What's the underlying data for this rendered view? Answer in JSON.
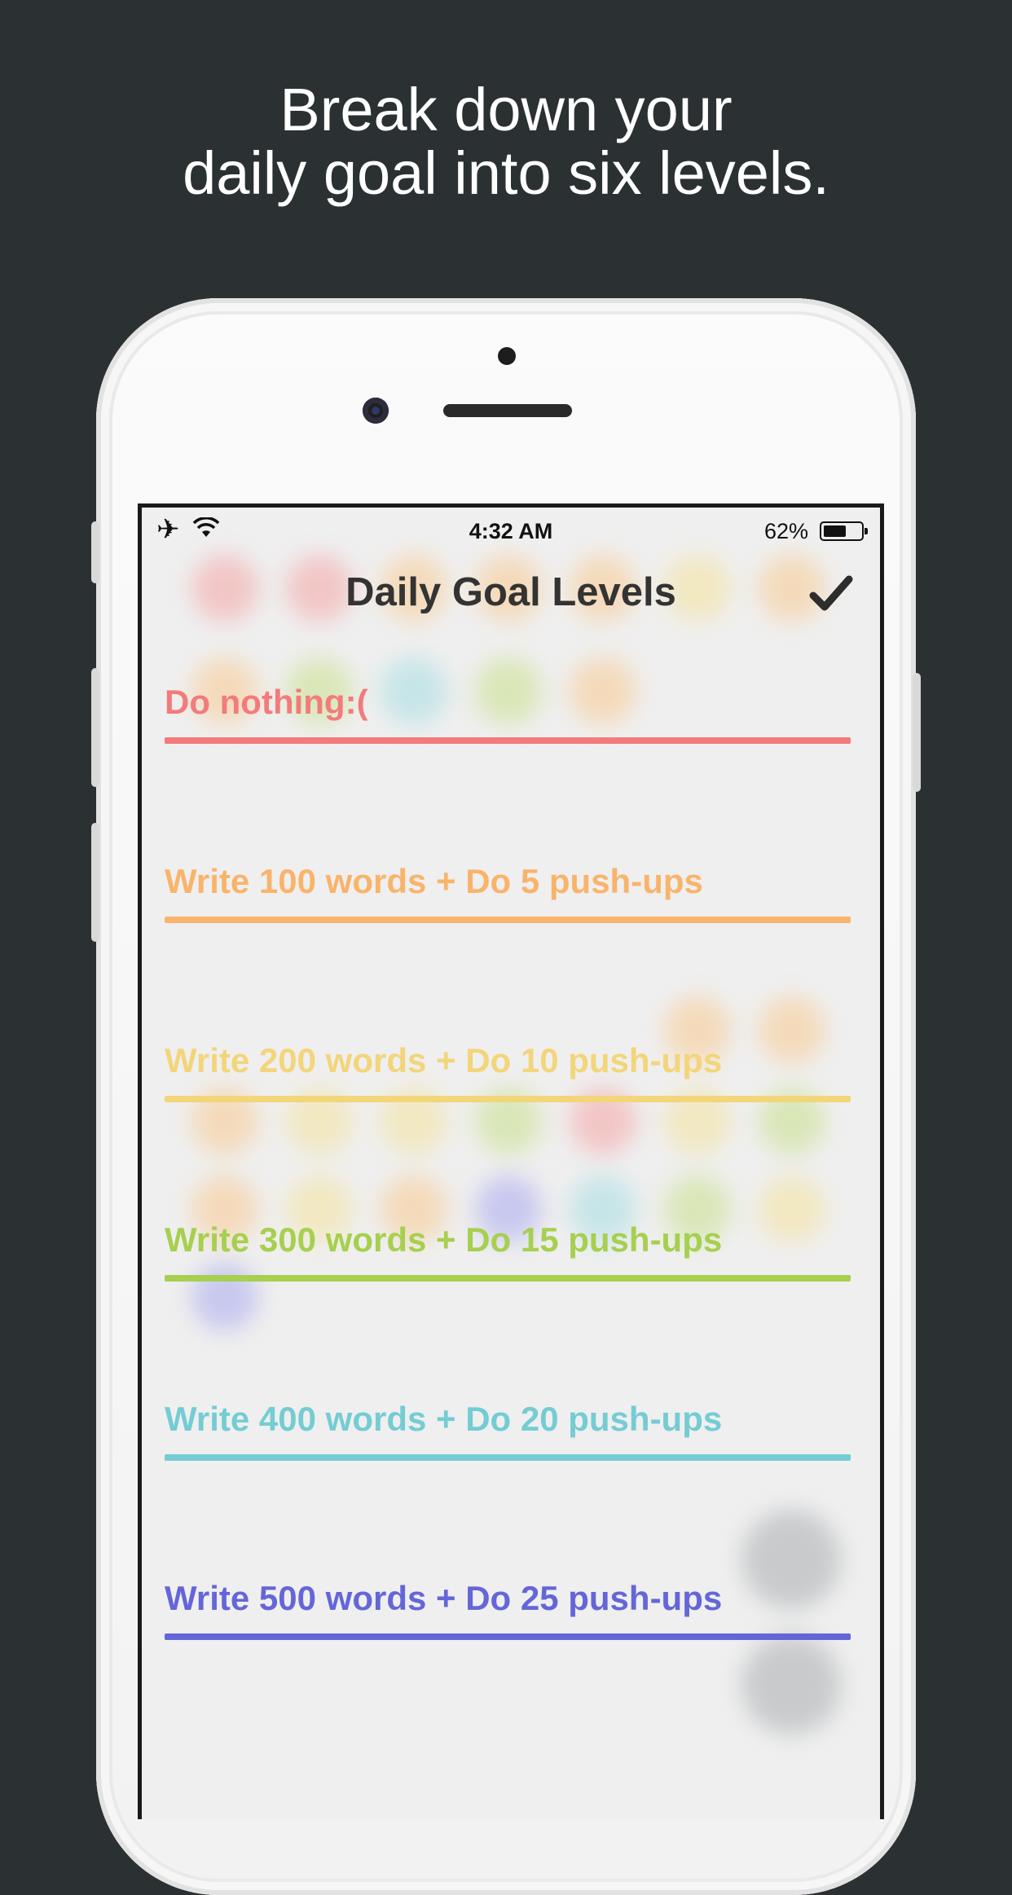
{
  "promo": {
    "headline_line1": "Break down your",
    "headline_line2": "daily goal into six levels."
  },
  "status_bar": {
    "time": "4:32 AM",
    "battery_percent": "62%",
    "battery_level": 0.62,
    "airplane_icon": "airplane-icon",
    "wifi_icon": "wifi-icon"
  },
  "nav": {
    "title": "Daily Goal Levels",
    "confirm_icon": "checkmark-icon"
  },
  "levels": [
    {
      "label": "Do nothing:(",
      "color": "#f37b7b"
    },
    {
      "label": "Write 100 words + Do 5 push-ups",
      "color": "#f9b46b"
    },
    {
      "label": "Write 200 words + Do 10 push-ups",
      "color": "#f3d57a"
    },
    {
      "label": "Write 300 words + Do 15 push-ups",
      "color": "#a7cf50"
    },
    {
      "label": "Write 400 words + Do 20 push-ups",
      "color": "#75ccd3"
    },
    {
      "label": "Write 500 words + Do 25 push-ups",
      "color": "#6466d8"
    }
  ]
}
